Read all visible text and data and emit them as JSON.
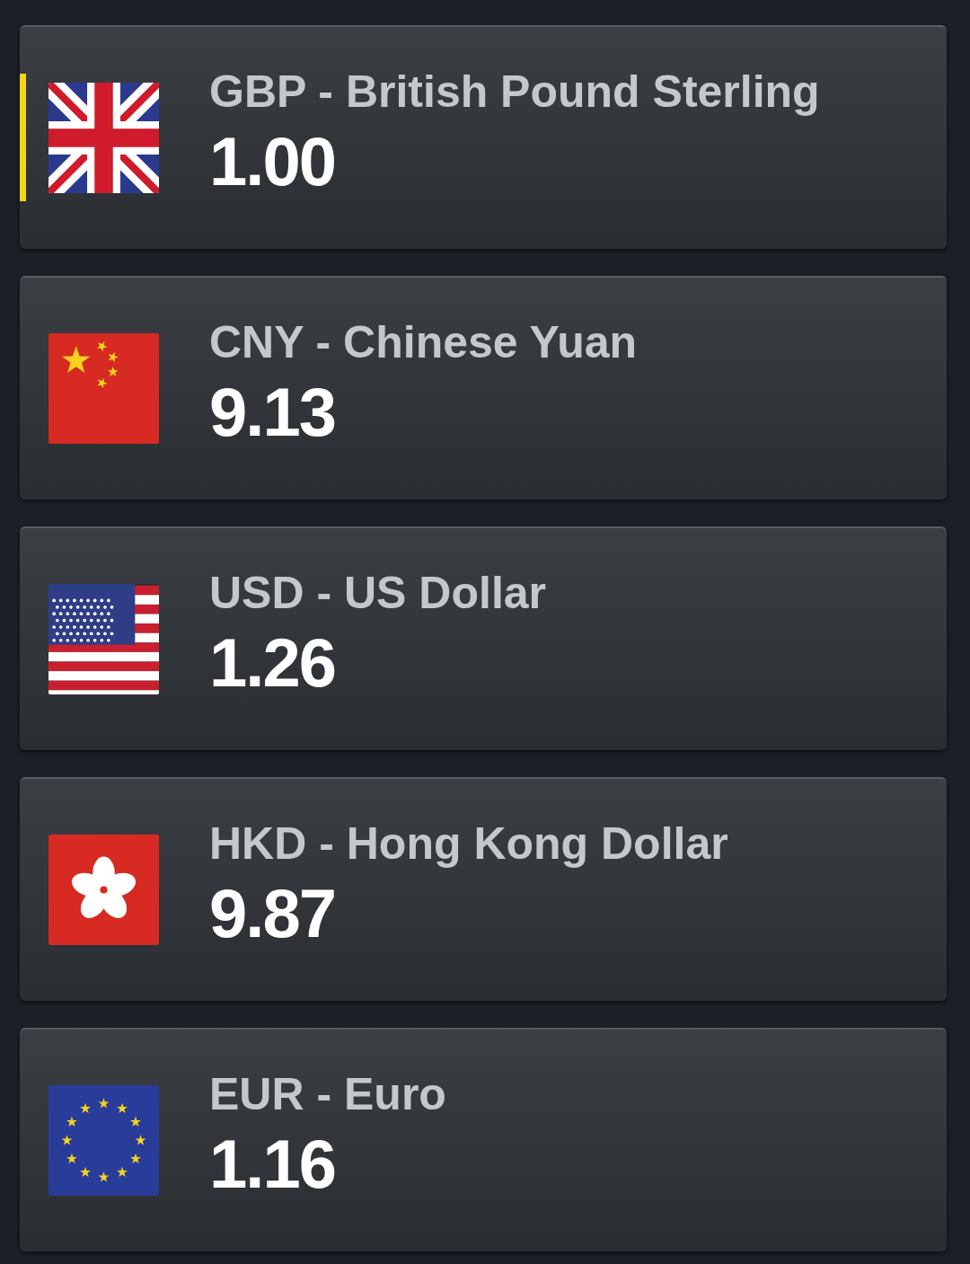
{
  "currencies": [
    {
      "kind": "gbp",
      "name": "GBP - British Pound Sterling",
      "value": "1.00",
      "selected": true
    },
    {
      "kind": "cny",
      "name": "CNY - Chinese Yuan",
      "value": "9.13",
      "selected": false
    },
    {
      "kind": "usd",
      "name": "USD - US Dollar",
      "value": "1.26",
      "selected": false
    },
    {
      "kind": "hkd",
      "name": "HKD - Hong Kong Dollar",
      "value": "9.87",
      "selected": false
    },
    {
      "kind": "eur",
      "name": "EUR - Euro",
      "value": "1.16",
      "selected": false
    }
  ]
}
